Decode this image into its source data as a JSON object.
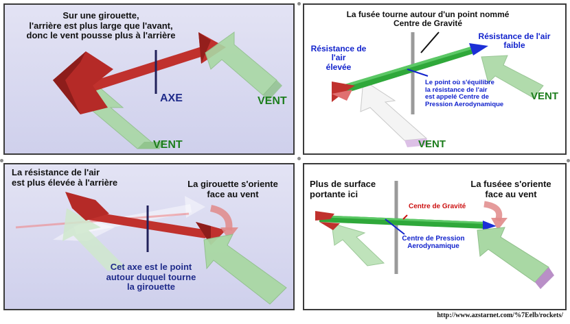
{
  "panel_1": {
    "caption": "Sur une girouette,\nl'arrière est plus large que l'avant,\ndonc le vent pousse plus à l'arrière",
    "axis_label": "AXE",
    "wind_label_right": "VENT",
    "wind_label_bottom": "VENT"
  },
  "panel_2": {
    "caption": "La fusée tourne autour d'un point nommé\nCentre de Gravité",
    "resistance_high": "Résistance de l'air\nélevée",
    "resistance_low": "Résistance de l'air\nfaible",
    "pressure_note": "Le point où s'équilibre\nla résistance de l'air\nest appelé Centre de\nPression Aerodynamique",
    "wind_label_right": "VENT",
    "wind_label_bottom": "VENT"
  },
  "panel_3": {
    "caption": "La résistance de l'air\nest plus élevée à l'arrière",
    "orient_label": "La girouette s'oriente\nface au vent",
    "axis_note": "Cet axe est le point\nautour duquel tourne\nla girouette"
  },
  "panel_4": {
    "surface_label": "Plus de surface\nportante ici",
    "orient_label": "La fuséee s'oriente\nface au vent",
    "gravity_label": "Centre de Gravité",
    "pressure_label": "Centre de Pression\nAerodynamique"
  },
  "source_url": "http://www.azstarnet.com/%7Eelb/rockets/",
  "colors": {
    "vane_red": "#c0312d",
    "rocket_green": "#2fa83a",
    "nose_blue": "#1c2fd6",
    "wind_green": "#a9d8a4",
    "wind_pink": "#dcc0e6",
    "axis_navy": "#20205a",
    "rod_gray": "#9a9a9a"
  }
}
